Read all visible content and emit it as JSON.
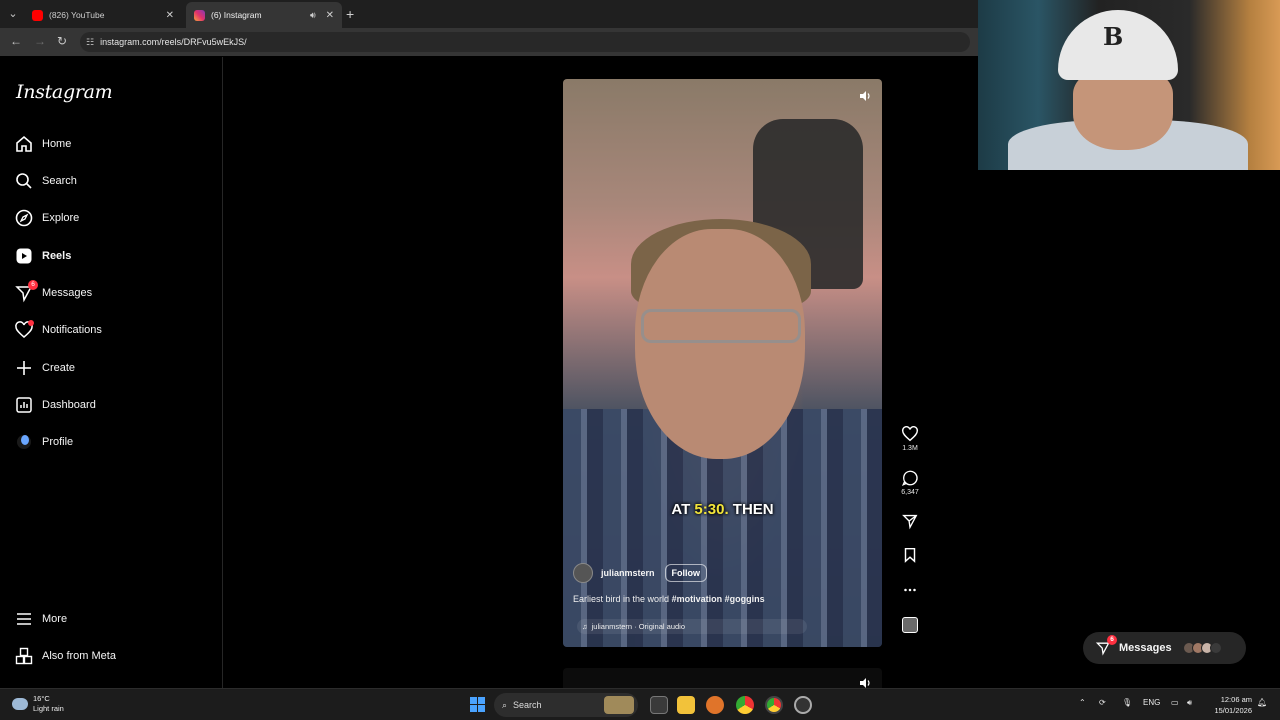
{
  "browser": {
    "tabs": [
      {
        "title": "(826) YouTube",
        "active": false
      },
      {
        "title": "(6) Instagram",
        "active": true
      }
    ],
    "url": "instagram.com/reels/DRFvu5wEkJS/"
  },
  "sidebar": {
    "logo": "Instagram",
    "items": [
      {
        "label": "Home"
      },
      {
        "label": "Search"
      },
      {
        "label": "Explore"
      },
      {
        "label": "Reels"
      },
      {
        "label": "Messages",
        "badge": "6"
      },
      {
        "label": "Notifications"
      },
      {
        "label": "Create"
      },
      {
        "label": "Dashboard"
      },
      {
        "label": "Profile"
      }
    ],
    "bottom": [
      {
        "label": "More"
      },
      {
        "label": "Also from Meta"
      }
    ]
  },
  "reel": {
    "subtitle_prefix": "AT",
    "subtitle_highlight": "5:30.",
    "subtitle_suffix": "THEN",
    "username": "julianmstern",
    "follow_label": "Follow",
    "caption_text": "Earliest bird in the world",
    "caption_tags": "#motivation #goggins",
    "audio": "julianmstern · Original audio",
    "likes": "1.3M",
    "comments": "6,347"
  },
  "messages_pill": {
    "label": "Messages",
    "badge": "6"
  },
  "taskbar": {
    "temp": "16°C",
    "weather": "Light rain",
    "search": "Search",
    "lang": "ENG",
    "time": "12:06 am",
    "date": "15/01/2026"
  },
  "colors": {
    "accent_red": "#ff3040",
    "subtitle_highlight": "#f3e53a",
    "windows_blue": "#4aa3ff"
  }
}
